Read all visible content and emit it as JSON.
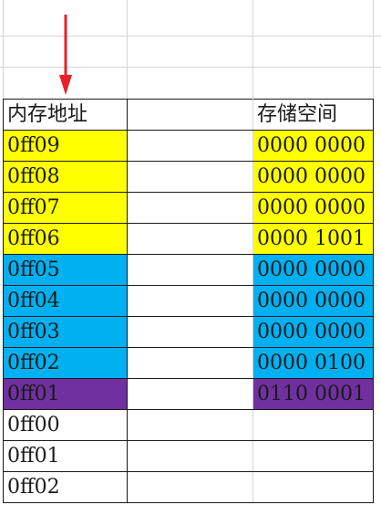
{
  "table": {
    "headers": {
      "address": "内存地址",
      "storage": "存储空间"
    },
    "rows": [
      {
        "address": "0ff09",
        "storage": "0000 0000",
        "color": "#ffff00"
      },
      {
        "address": "0ff08",
        "storage": "0000 0000",
        "color": "#ffff00"
      },
      {
        "address": "0ff07",
        "storage": "0000 0000",
        "color": "#ffff00"
      },
      {
        "address": "0ff06",
        "storage": "0000 1001",
        "color": "#ffff00"
      },
      {
        "address": "0ff05",
        "storage": "0000 0000",
        "color": "#00b0f0"
      },
      {
        "address": "0ff04",
        "storage": "0000 0000",
        "color": "#00b0f0"
      },
      {
        "address": "0ff03",
        "storage": "0000 0000",
        "color": "#00b0f0"
      },
      {
        "address": "0ff02",
        "storage": "0000 0100",
        "color": "#00b0f0"
      },
      {
        "address": "0ff01",
        "storage": "0110 0001",
        "color": "#7030a0"
      },
      {
        "address": "0ff00",
        "storage": "",
        "color": "#ffffff"
      },
      {
        "address": "0ff01",
        "storage": "",
        "color": "#ffffff"
      },
      {
        "address": "0ff02",
        "storage": "",
        "color": "#ffffff"
      }
    ]
  },
  "arrow": {
    "icon": "down-arrow-icon",
    "color": "#e8202a"
  },
  "colors": {
    "yellow": "#ffff00",
    "blue": "#00b0f0",
    "purple": "#7030a0",
    "gridline": "#d4d4d4"
  }
}
